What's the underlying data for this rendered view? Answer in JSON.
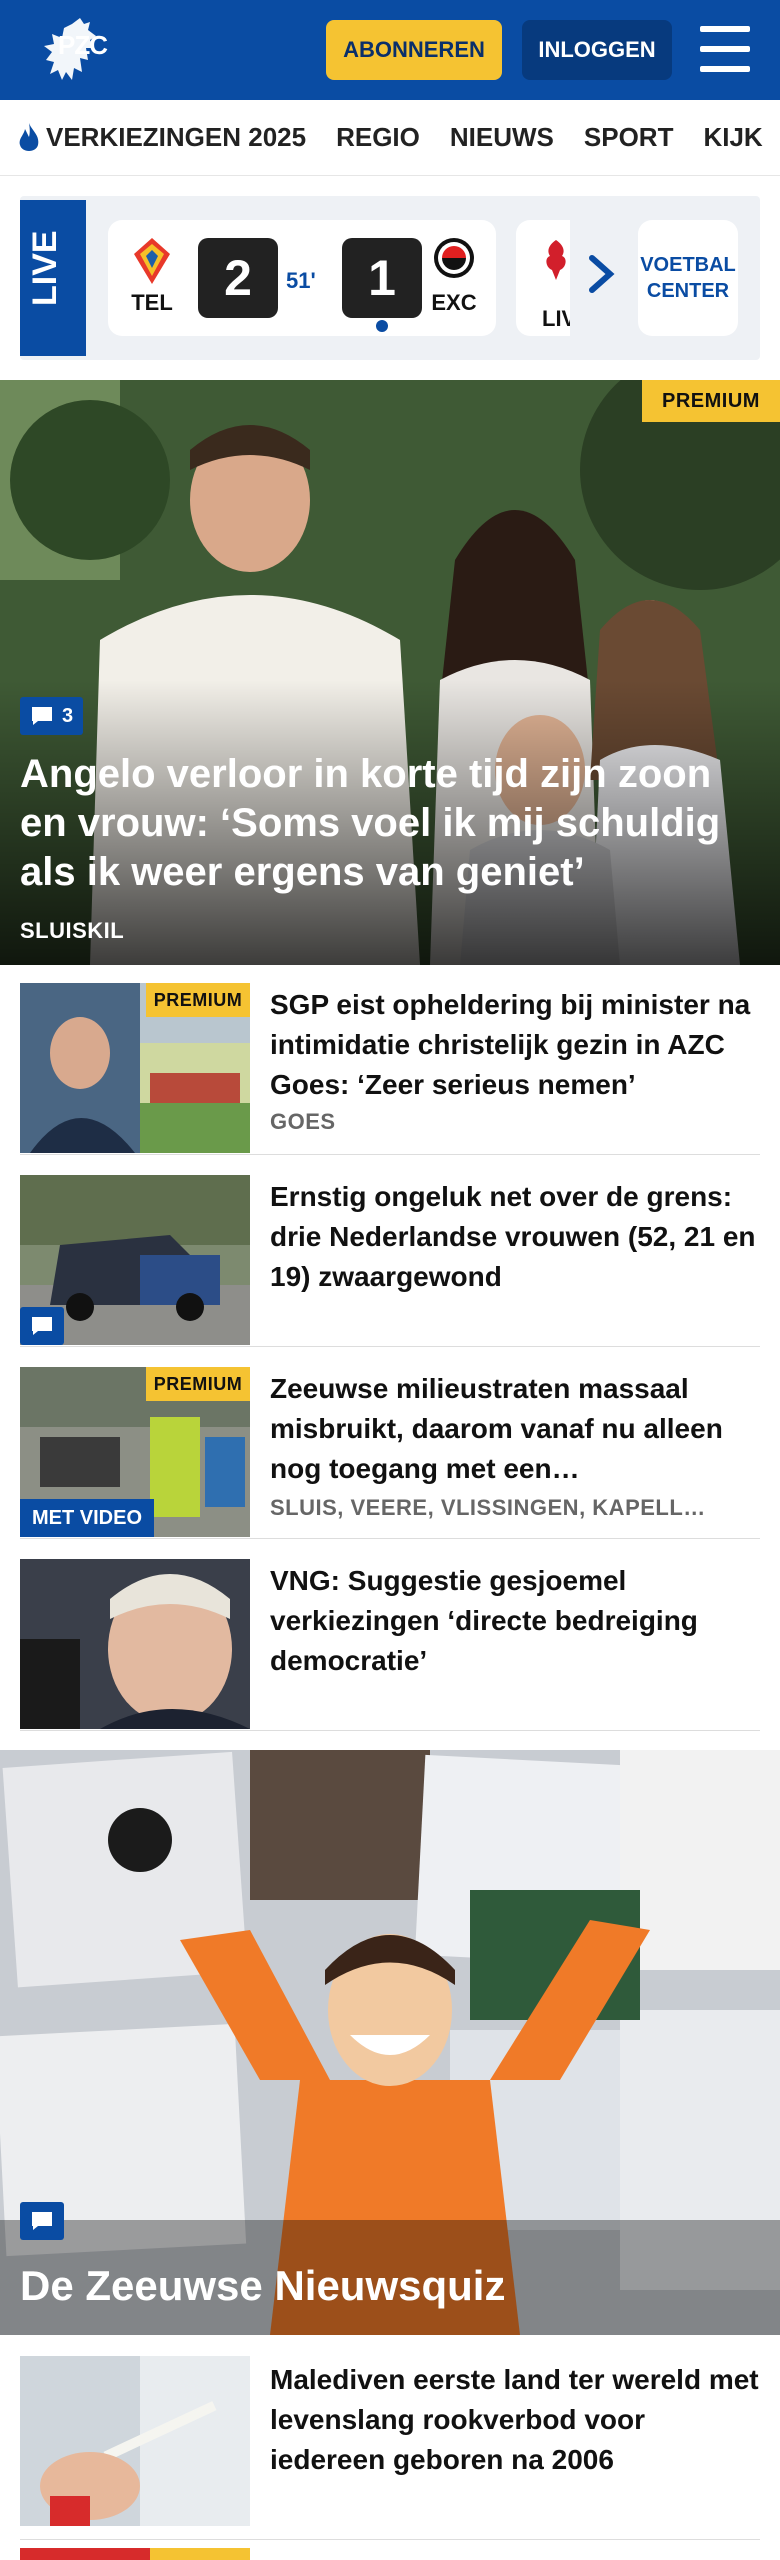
{
  "header": {
    "logo_text": "PZC",
    "subscribe_label": "ABONNEREN",
    "login_label": "INLOGGEN"
  },
  "nav": {
    "items": [
      "VERKIEZINGEN 2025",
      "REGIO",
      "NIEUWS",
      "SPORT",
      "KIJK"
    ]
  },
  "live": {
    "label": "LIVE",
    "match": {
      "home_team": "TEL",
      "away_team": "EXC",
      "home_score": "2",
      "away_score": "1",
      "minute": "51'"
    },
    "next_team": "LIV",
    "voetbal_center": "VOETBAL CENTER"
  },
  "hero": {
    "premium_label": "PREMIUM",
    "comment_count": "3",
    "title": "Angelo verloor in korte tijd zijn zoon en vrouw: ‘Soms voel ik mij schuldig als ik weer ergens van geniet’",
    "location": "SLUISKIL"
  },
  "articles": [
    {
      "title": "SGP eist opheldering bij minister na intimidatie christelijk gezin in AZC Goes: ‘Zeer serieus nemen’",
      "location": "GOES",
      "premium": "PREMIUM"
    },
    {
      "title": "Ernstig ongeluk net over de grens: drie Nederlandse vrouwen (52, 21 en 19) zwaargewond",
      "location": ""
    },
    {
      "title": "Zeeuwse milieustraten massaal misbruikt, daarom vanaf nu alleen nog toegang met een…",
      "location": "SLUIS, VEERE, VLISSINGEN, KAPELL…",
      "premium": "PREMIUM",
      "video_label": "MET VIDEO"
    },
    {
      "title": "VNG: Suggestie gesjoemel verkiezingen ‘directe bedreiging democratie’",
      "location": ""
    }
  ],
  "quiz": {
    "title": "De Zeeuwse Nieuwsquiz"
  },
  "article_after_quiz": {
    "title": "Malediven eerste land ter wereld met levenslang rookverbod voor iedereen geboren na 2006"
  },
  "colors": {
    "brand_blue": "#0a4ca3",
    "premium_yellow": "#f5c332",
    "login_blue": "#073a7e"
  }
}
